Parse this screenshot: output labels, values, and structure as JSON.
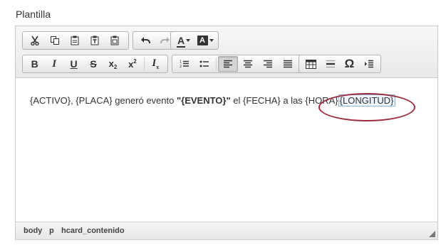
{
  "field": {
    "label": "Plantilla"
  },
  "toolbar": {
    "font_color_letter": "A",
    "bg_color_letter": "A",
    "bold": "B",
    "italic": "I",
    "underline": "U",
    "strike": "S",
    "subscript": "x",
    "subscript_mark": "2",
    "superscript": "x",
    "superscript_mark": "2",
    "clear_format": "I",
    "clear_format_mark": "x",
    "special_char": "Ω",
    "icons": [
      "cut-icon",
      "copy-icon",
      "paste-icon",
      "paste-text-icon",
      "paste-word-icon",
      "undo-icon",
      "redo-icon",
      "text-color-icon",
      "bg-color-icon",
      "bold-icon",
      "italic-icon",
      "underline-icon",
      "strikethrough-icon",
      "subscript-icon",
      "superscript-icon",
      "remove-format-icon",
      "numbered-list-icon",
      "bulleted-list-icon",
      "align-left-icon",
      "align-center-icon",
      "align-right-icon",
      "align-justify-icon",
      "table-icon",
      "horizontal-line-icon",
      "special-char-icon",
      "indent-block-icon"
    ]
  },
  "content": {
    "part1": "{ACTIVO}, {PLACA} generó evento ",
    "event": "\"{EVENTO}\"",
    "part2": " el  {FECHA} a las {HORA}",
    "selected": "{LONGITUD}"
  },
  "statusbar": {
    "crumbs": [
      "body",
      "p",
      "hcard_contenido"
    ]
  },
  "colors": {
    "annotation": "#9c2b3d",
    "selection_border": "#8fb5e0"
  }
}
